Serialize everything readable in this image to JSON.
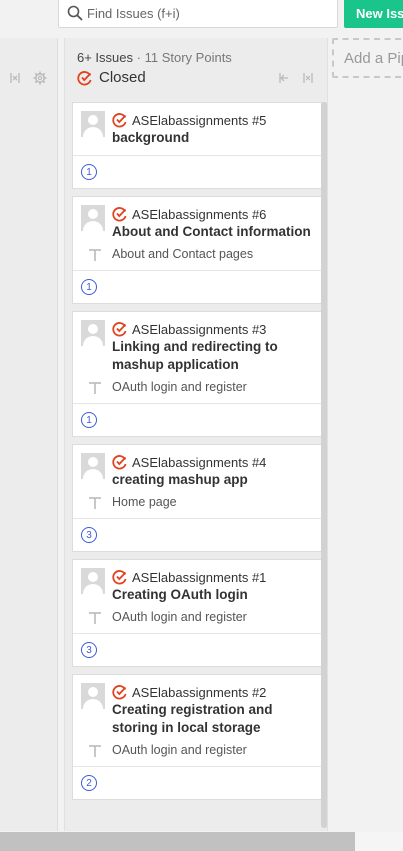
{
  "search": {
    "placeholder": "Find Issues (f+i)"
  },
  "toolbar": {
    "new_issue_label": "New Issue"
  },
  "add_pipeline_label": "Add a Pipeline",
  "column": {
    "count_label": "6+ Issues",
    "separator": "·",
    "points_label": "11 Story Points",
    "title": "Closed"
  },
  "cards": [
    {
      "repo": "ASElabassignments #5",
      "title": "background",
      "epic": "",
      "estimate": "1"
    },
    {
      "repo": "ASElabassignments #6",
      "title": "About and Contact information",
      "epic": "About and Contact pages",
      "estimate": "1"
    },
    {
      "repo": "ASElabassignments #3",
      "title": "Linking and redirecting to mashup application",
      "epic": "OAuth login and register",
      "estimate": "1"
    },
    {
      "repo": "ASElabassignments #4",
      "title": "creating mashup app",
      "epic": "Home page",
      "estimate": "3"
    },
    {
      "repo": "ASElabassignments #1",
      "title": "Creating OAuth login",
      "epic": "OAuth login and register",
      "estimate": "3"
    },
    {
      "repo": "ASElabassignments #2",
      "title": "Creating registration and storing in local storage",
      "epic": "OAuth login and register",
      "estimate": "2"
    }
  ],
  "colors": {
    "accent_green": "#19c58a",
    "closed_red": "#e0441f",
    "estimate_blue": "#3b5bdb"
  },
  "icons": [
    "search-icon",
    "collapse-icon",
    "settings-icon",
    "closed-issue-icon",
    "expand-icon",
    "avatar-icon",
    "epic-pin-icon"
  ]
}
